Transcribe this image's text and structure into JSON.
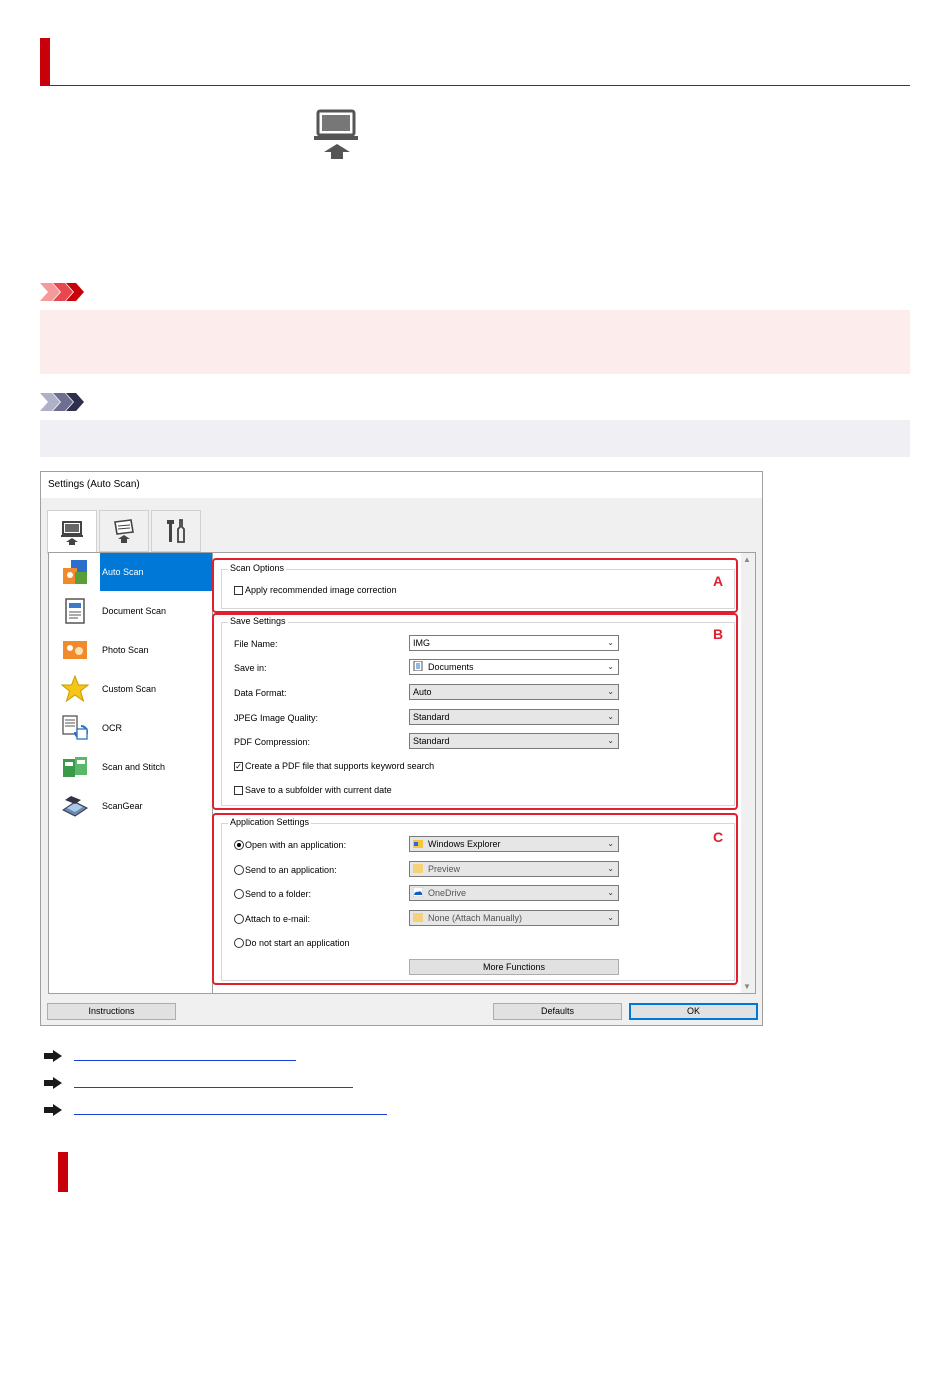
{
  "dialog": {
    "title": "Settings (Auto Scan)",
    "nav": [
      {
        "label": "Auto Scan",
        "icon": "auto-scan-icon",
        "selected": true
      },
      {
        "label": "Document Scan",
        "icon": "document-scan-icon",
        "selected": false
      },
      {
        "label": "Photo Scan",
        "icon": "photo-scan-icon",
        "selected": false
      },
      {
        "label": "Custom Scan",
        "icon": "star-icon",
        "selected": false
      },
      {
        "label": "OCR",
        "icon": "ocr-icon",
        "selected": false
      },
      {
        "label": "Scan and Stitch",
        "icon": "scan-stitch-icon",
        "selected": false
      },
      {
        "label": "ScanGear",
        "icon": "scangear-icon",
        "selected": false
      }
    ],
    "scan_options": {
      "title": "Scan Options",
      "apply_correction": {
        "label": "Apply recommended image correction",
        "checked": false
      },
      "marker": "A"
    },
    "save_settings": {
      "title": "Save Settings",
      "marker": "B",
      "file_name": {
        "label": "File Name:",
        "value": "IMG"
      },
      "save_in": {
        "label": "Save in:",
        "value": "Documents"
      },
      "data_format": {
        "label": "Data Format:",
        "value": "Auto"
      },
      "jpeg_quality": {
        "label": "JPEG Image Quality:",
        "value": "Standard"
      },
      "pdf_compression": {
        "label": "PDF Compression:",
        "value": "Standard"
      },
      "keyword_pdf": {
        "label": "Create a PDF file that supports keyword search",
        "checked": true
      },
      "subfolder": {
        "label": "Save to a subfolder with current date",
        "checked": false
      }
    },
    "app_settings": {
      "title": "Application Settings",
      "marker": "C",
      "open_app": {
        "label": "Open with an application:",
        "value": "Windows Explorer",
        "selected": true
      },
      "send_app": {
        "label": "Send to an application:",
        "value": "Preview",
        "selected": false
      },
      "send_folder": {
        "label": "Send to a folder:",
        "value": "OneDrive",
        "selected": false
      },
      "attach_email": {
        "label": "Attach to e-mail:",
        "value": "None (Attach Manually)",
        "selected": false
      },
      "no_app": {
        "label": "Do not start an application",
        "selected": false
      },
      "more_functions": "More Functions"
    },
    "buttons": {
      "instructions": "Instructions",
      "defaults": "Defaults",
      "ok": "OK"
    }
  },
  "colors": {
    "accent_red": "#c8000a",
    "marker_red": "#e0202e",
    "select_blue": "#0078d7",
    "link_blue": "#1a3fd1"
  }
}
